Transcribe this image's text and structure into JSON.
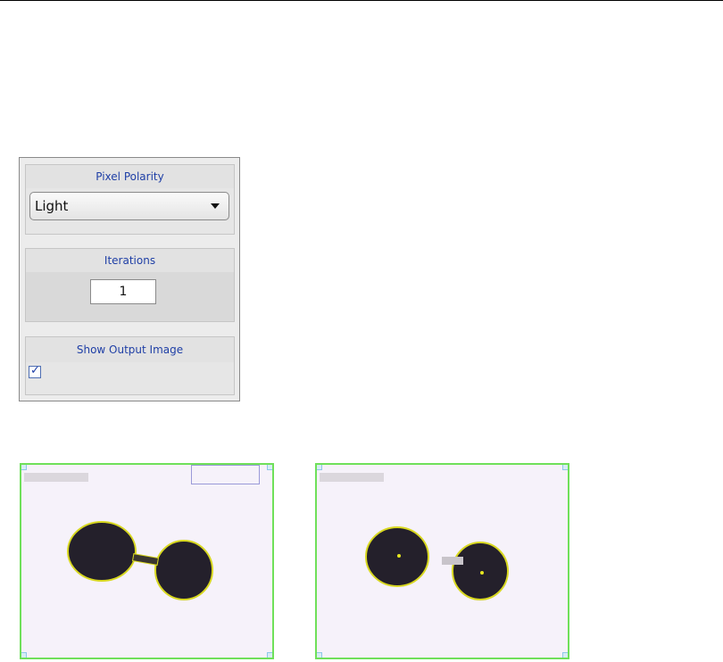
{
  "controls": {
    "pixel_polarity": {
      "label": "Pixel Polarity",
      "selected": "Light"
    },
    "iterations": {
      "label": "Iterations",
      "value": "1"
    },
    "show_output_image": {
      "label": "Show Output Image",
      "checked": true,
      "check_glyph": "✓"
    }
  },
  "images": {
    "left": {
      "description": "input-image-preview",
      "border_color": "#6fe05a"
    },
    "right": {
      "description": "output-image-preview",
      "border_color": "#6fe05a"
    }
  }
}
